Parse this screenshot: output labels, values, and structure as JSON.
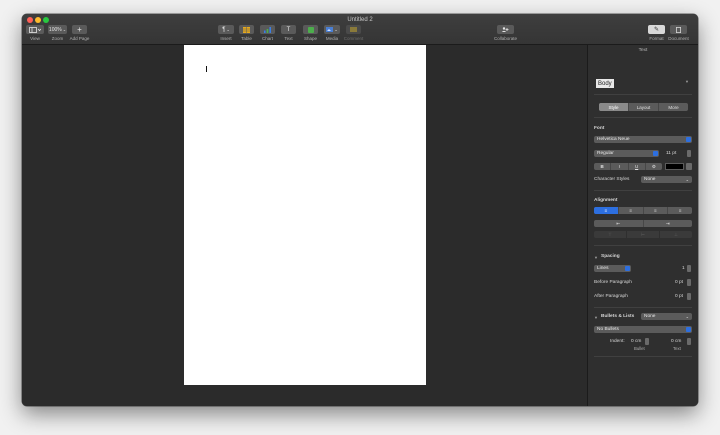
{
  "window": {
    "title": "Untitled 2"
  },
  "toolbar": {
    "view_label": "View",
    "zoom_value": "100%",
    "zoom_label": "Zoom",
    "add_page_label": "Add Page",
    "insert_label": "Insert",
    "table_label": "Table",
    "chart_label": "Chart",
    "text_label": "Text",
    "shape_label": "Shape",
    "media_label": "Media",
    "comment_label": "Comment",
    "collaborate_label": "Collaborate",
    "format_label": "Format",
    "document_label": "Document"
  },
  "inspector": {
    "header": "Text",
    "paragraph_style": "Body",
    "tabs": [
      "Style",
      "Layout",
      "More"
    ],
    "active_tab": "Style",
    "font_section": "Font",
    "font_family": "Helvetica Neue",
    "font_typeface": "Regular",
    "font_size": "11 pt",
    "format_buttons": [
      "B",
      "I",
      "U",
      "⚙"
    ],
    "character_styles_label": "Character Styles",
    "character_styles_value": "None",
    "alignment_section": "Alignment",
    "align_buttons": [
      "≡",
      "≡",
      "≡",
      "≡"
    ],
    "indent_buttons": [
      "⇤",
      "⇥"
    ],
    "valign_buttons": [
      "⊤",
      "⊢",
      "⊥"
    ],
    "spacing_section": "Spacing",
    "spacing_mode": "Lines",
    "spacing_value": "1",
    "before_paragraph_label": "Before Paragraph",
    "before_paragraph_value": "0 pt",
    "after_paragraph_label": "After Paragraph",
    "after_paragraph_value": "0 pt",
    "bullets_section": "Bullets & Lists",
    "bullets_style": "None",
    "bullets_value": "No Bullets",
    "indent_label": "Indent:",
    "bullet_indent_value": "0 cm",
    "text_indent_value": "0 cm",
    "bullet_caption": "Bullet",
    "text_caption": "Text"
  },
  "colors": {
    "accent": "#2d6fe0",
    "window_bg": "#2d2d2d",
    "toolbar_button": "#5a5a5a",
    "table_icon": "#e6a91c",
    "chart_icon": "#3a7ee4",
    "shape_icon": "#4cae4c",
    "media_icon": "#4a7fd4"
  }
}
